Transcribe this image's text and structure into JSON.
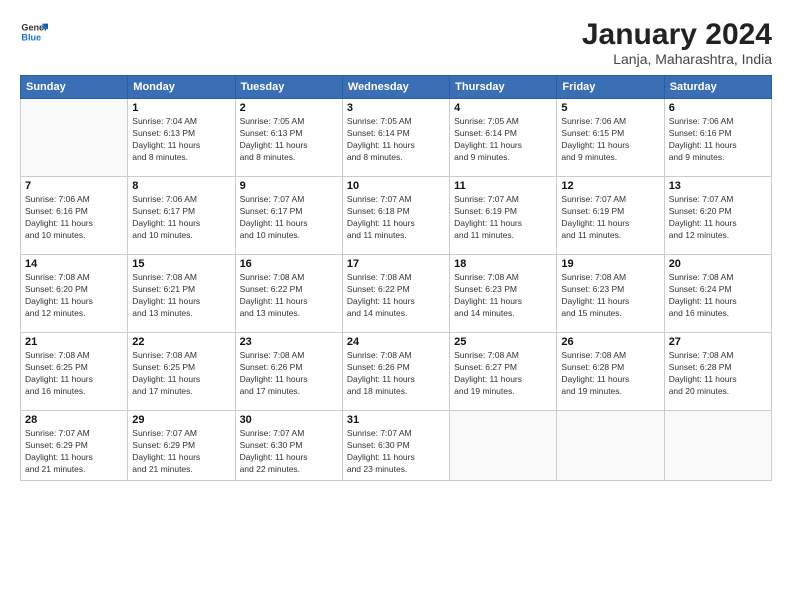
{
  "logo": {
    "line1": "General",
    "line2": "Blue"
  },
  "title": "January 2024",
  "subtitle": "Lanja, Maharashtra, India",
  "weekdays": [
    "Sunday",
    "Monday",
    "Tuesday",
    "Wednesday",
    "Thursday",
    "Friday",
    "Saturday"
  ],
  "weeks": [
    [
      {
        "day": "",
        "info": ""
      },
      {
        "day": "1",
        "info": "Sunrise: 7:04 AM\nSunset: 6:13 PM\nDaylight: 11 hours\nand 8 minutes."
      },
      {
        "day": "2",
        "info": "Sunrise: 7:05 AM\nSunset: 6:13 PM\nDaylight: 11 hours\nand 8 minutes."
      },
      {
        "day": "3",
        "info": "Sunrise: 7:05 AM\nSunset: 6:14 PM\nDaylight: 11 hours\nand 8 minutes."
      },
      {
        "day": "4",
        "info": "Sunrise: 7:05 AM\nSunset: 6:14 PM\nDaylight: 11 hours\nand 9 minutes."
      },
      {
        "day": "5",
        "info": "Sunrise: 7:06 AM\nSunset: 6:15 PM\nDaylight: 11 hours\nand 9 minutes."
      },
      {
        "day": "6",
        "info": "Sunrise: 7:06 AM\nSunset: 6:16 PM\nDaylight: 11 hours\nand 9 minutes."
      }
    ],
    [
      {
        "day": "7",
        "info": "Sunrise: 7:06 AM\nSunset: 6:16 PM\nDaylight: 11 hours\nand 10 minutes."
      },
      {
        "day": "8",
        "info": "Sunrise: 7:06 AM\nSunset: 6:17 PM\nDaylight: 11 hours\nand 10 minutes."
      },
      {
        "day": "9",
        "info": "Sunrise: 7:07 AM\nSunset: 6:17 PM\nDaylight: 11 hours\nand 10 minutes."
      },
      {
        "day": "10",
        "info": "Sunrise: 7:07 AM\nSunset: 6:18 PM\nDaylight: 11 hours\nand 11 minutes."
      },
      {
        "day": "11",
        "info": "Sunrise: 7:07 AM\nSunset: 6:19 PM\nDaylight: 11 hours\nand 11 minutes."
      },
      {
        "day": "12",
        "info": "Sunrise: 7:07 AM\nSunset: 6:19 PM\nDaylight: 11 hours\nand 11 minutes."
      },
      {
        "day": "13",
        "info": "Sunrise: 7:07 AM\nSunset: 6:20 PM\nDaylight: 11 hours\nand 12 minutes."
      }
    ],
    [
      {
        "day": "14",
        "info": "Sunrise: 7:08 AM\nSunset: 6:20 PM\nDaylight: 11 hours\nand 12 minutes."
      },
      {
        "day": "15",
        "info": "Sunrise: 7:08 AM\nSunset: 6:21 PM\nDaylight: 11 hours\nand 13 minutes."
      },
      {
        "day": "16",
        "info": "Sunrise: 7:08 AM\nSunset: 6:22 PM\nDaylight: 11 hours\nand 13 minutes."
      },
      {
        "day": "17",
        "info": "Sunrise: 7:08 AM\nSunset: 6:22 PM\nDaylight: 11 hours\nand 14 minutes."
      },
      {
        "day": "18",
        "info": "Sunrise: 7:08 AM\nSunset: 6:23 PM\nDaylight: 11 hours\nand 14 minutes."
      },
      {
        "day": "19",
        "info": "Sunrise: 7:08 AM\nSunset: 6:23 PM\nDaylight: 11 hours\nand 15 minutes."
      },
      {
        "day": "20",
        "info": "Sunrise: 7:08 AM\nSunset: 6:24 PM\nDaylight: 11 hours\nand 16 minutes."
      }
    ],
    [
      {
        "day": "21",
        "info": "Sunrise: 7:08 AM\nSunset: 6:25 PM\nDaylight: 11 hours\nand 16 minutes."
      },
      {
        "day": "22",
        "info": "Sunrise: 7:08 AM\nSunset: 6:25 PM\nDaylight: 11 hours\nand 17 minutes."
      },
      {
        "day": "23",
        "info": "Sunrise: 7:08 AM\nSunset: 6:26 PM\nDaylight: 11 hours\nand 17 minutes."
      },
      {
        "day": "24",
        "info": "Sunrise: 7:08 AM\nSunset: 6:26 PM\nDaylight: 11 hours\nand 18 minutes."
      },
      {
        "day": "25",
        "info": "Sunrise: 7:08 AM\nSunset: 6:27 PM\nDaylight: 11 hours\nand 19 minutes."
      },
      {
        "day": "26",
        "info": "Sunrise: 7:08 AM\nSunset: 6:28 PM\nDaylight: 11 hours\nand 19 minutes."
      },
      {
        "day": "27",
        "info": "Sunrise: 7:08 AM\nSunset: 6:28 PM\nDaylight: 11 hours\nand 20 minutes."
      }
    ],
    [
      {
        "day": "28",
        "info": "Sunrise: 7:07 AM\nSunset: 6:29 PM\nDaylight: 11 hours\nand 21 minutes."
      },
      {
        "day": "29",
        "info": "Sunrise: 7:07 AM\nSunset: 6:29 PM\nDaylight: 11 hours\nand 21 minutes."
      },
      {
        "day": "30",
        "info": "Sunrise: 7:07 AM\nSunset: 6:30 PM\nDaylight: 11 hours\nand 22 minutes."
      },
      {
        "day": "31",
        "info": "Sunrise: 7:07 AM\nSunset: 6:30 PM\nDaylight: 11 hours\nand 23 minutes."
      },
      {
        "day": "",
        "info": ""
      },
      {
        "day": "",
        "info": ""
      },
      {
        "day": "",
        "info": ""
      }
    ]
  ]
}
